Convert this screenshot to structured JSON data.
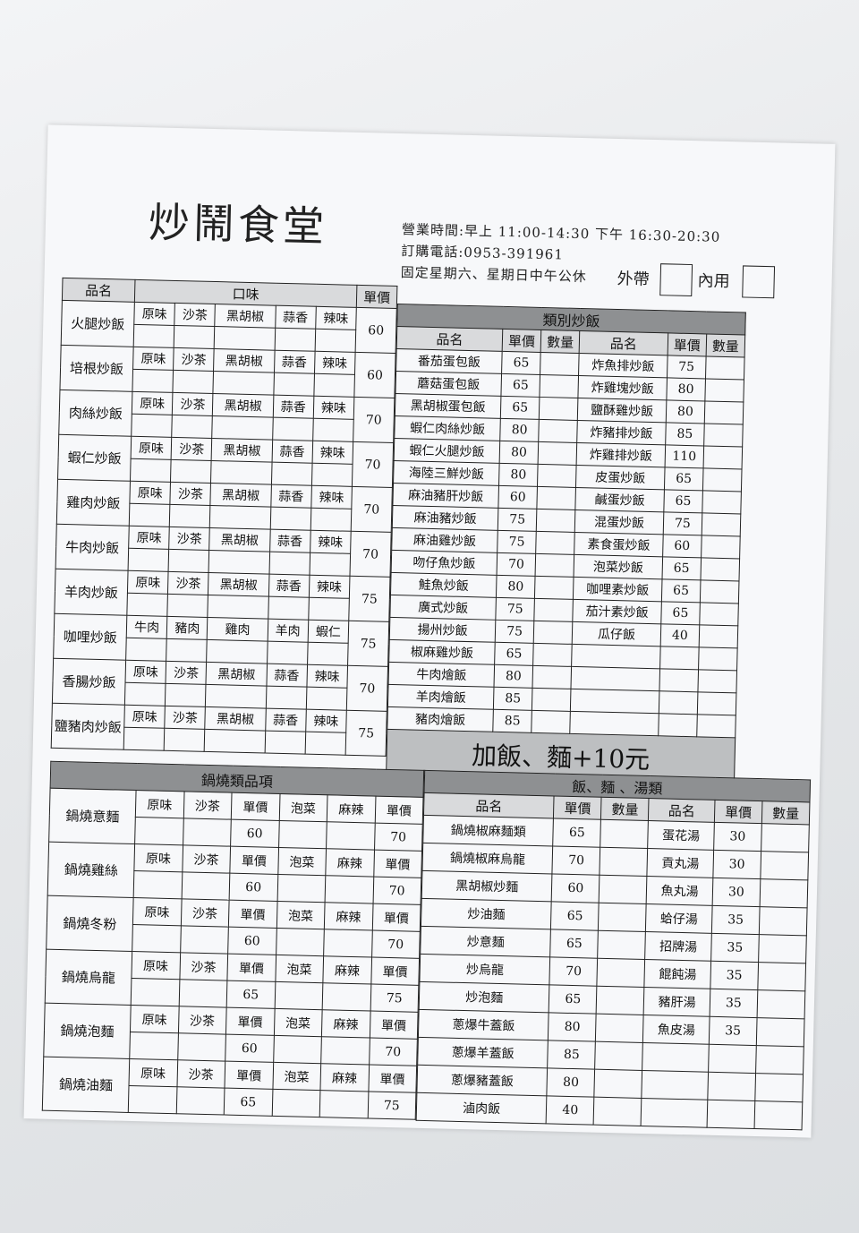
{
  "title": "炒鬧食堂",
  "info": {
    "hours": "營業時間:早上 11:00-14:30 下午 16:30-20:30",
    "phone": "訂購電話:0953-391961",
    "closed": "固定星期六、星期日中午公休",
    "takeout": "外帶",
    "dinein": "內用"
  },
  "left": {
    "col_name": "品名",
    "col_flavor": "口味",
    "col_price": "單價",
    "rows": [
      {
        "name": "火腿炒飯",
        "opts": [
          "原味",
          "沙茶",
          "黑胡椒",
          "蒜香",
          "辣味"
        ],
        "price": "60"
      },
      {
        "name": "培根炒飯",
        "opts": [
          "原味",
          "沙茶",
          "黑胡椒",
          "蒜香",
          "辣味"
        ],
        "price": "60"
      },
      {
        "name": "肉絲炒飯",
        "opts": [
          "原味",
          "沙茶",
          "黑胡椒",
          "蒜香",
          "辣味"
        ],
        "price": "70"
      },
      {
        "name": "蝦仁炒飯",
        "opts": [
          "原味",
          "沙茶",
          "黑胡椒",
          "蒜香",
          "辣味"
        ],
        "price": "70"
      },
      {
        "name": "雞肉炒飯",
        "opts": [
          "原味",
          "沙茶",
          "黑胡椒",
          "蒜香",
          "辣味"
        ],
        "price": "70"
      },
      {
        "name": "牛肉炒飯",
        "opts": [
          "原味",
          "沙茶",
          "黑胡椒",
          "蒜香",
          "辣味"
        ],
        "price": "70"
      },
      {
        "name": "羊肉炒飯",
        "opts": [
          "原味",
          "沙茶",
          "黑胡椒",
          "蒜香",
          "辣味"
        ],
        "price": "75"
      },
      {
        "name": "咖哩炒飯",
        "opts": [
          "牛肉",
          "豬肉",
          "雞肉",
          "羊肉",
          "蝦仁"
        ],
        "price": "75"
      },
      {
        "name": "香腸炒飯",
        "opts": [
          "原味",
          "沙茶",
          "黑胡椒",
          "蒜香",
          "辣味"
        ],
        "price": "70"
      },
      {
        "name": "鹽豬肉炒飯",
        "opts": [
          "原味",
          "沙茶",
          "黑胡椒",
          "蒜香",
          "辣味"
        ],
        "price": "75"
      }
    ]
  },
  "special": {
    "header": "類別炒飯",
    "col_name": "品名",
    "col_price": "單價",
    "col_qty": "數量",
    "left": [
      [
        "番茄蛋包飯",
        "65"
      ],
      [
        "蘑菇蛋包飯",
        "65"
      ],
      [
        "黑胡椒蛋包飯",
        "65"
      ],
      [
        "蝦仁肉絲炒飯",
        "80"
      ],
      [
        "蝦仁火腿炒飯",
        "80"
      ],
      [
        "海陸三鮮炒飯",
        "80"
      ],
      [
        "麻油豬肝炒飯",
        "60"
      ],
      [
        "麻油豬炒飯",
        "75"
      ],
      [
        "麻油雞炒飯",
        "75"
      ],
      [
        "吻仔魚炒飯",
        "70"
      ],
      [
        "鮭魚炒飯",
        "80"
      ],
      [
        "廣式炒飯",
        "75"
      ],
      [
        "揚州炒飯",
        "75"
      ],
      [
        "椒麻雞炒飯",
        "65"
      ],
      [
        "牛肉燴飯",
        "80"
      ],
      [
        "羊肉燴飯",
        "85"
      ],
      [
        "豬肉燴飯",
        "85"
      ]
    ],
    "right": [
      [
        "炸魚排炒飯",
        "75"
      ],
      [
        "炸雞塊炒飯",
        "80"
      ],
      [
        "鹽酥雞炒飯",
        "80"
      ],
      [
        "炸豬排炒飯",
        "85"
      ],
      [
        "炸雞排炒飯",
        "110"
      ],
      [
        "皮蛋炒飯",
        "65"
      ],
      [
        "鹹蛋炒飯",
        "65"
      ],
      [
        "混蛋炒飯",
        "75"
      ],
      [
        "素食蛋炒飯",
        "60"
      ],
      [
        "泡菜炒飯",
        "65"
      ],
      [
        "咖哩素炒飯",
        "65"
      ],
      [
        "茄汁素炒飯",
        "65"
      ],
      [
        "瓜仔飯",
        "40"
      ]
    ]
  },
  "banner": "加飯、麵+10元",
  "pot": {
    "header": "鍋燒類品項",
    "rows": [
      {
        "name": "鍋燒意麵",
        "p1": "60",
        "p2": "70"
      },
      {
        "name": "鍋燒雞絲",
        "p1": "60",
        "p2": "70"
      },
      {
        "name": "鍋燒冬粉",
        "p1": "60",
        "p2": "70"
      },
      {
        "name": "鍋燒烏龍",
        "p1": "65",
        "p2": "75"
      },
      {
        "name": "鍋燒泡麵",
        "p1": "60",
        "p2": "70"
      },
      {
        "name": "鍋燒油麵",
        "p1": "65",
        "p2": "75"
      }
    ],
    "o1": "原味",
    "o2": "沙茶",
    "pr": "單價",
    "o3": "泡菜",
    "o4": "麻辣"
  },
  "noodles": {
    "header": "飯、麵 、湯類",
    "col_name": "品名",
    "col_price": "單價",
    "col_qty": "數量",
    "left": [
      [
        "鍋燒椒麻麵類",
        "65"
      ],
      [
        "鍋燒椒麻烏龍",
        "70"
      ],
      [
        "黑胡椒炒麵",
        "60"
      ],
      [
        "炒油麵",
        "65"
      ],
      [
        "炒意麵",
        "65"
      ],
      [
        "炒烏龍",
        "70"
      ],
      [
        "炒泡麵",
        "65"
      ],
      [
        "蔥爆牛蓋飯",
        "80"
      ],
      [
        "蔥爆羊蓋飯",
        "85"
      ],
      [
        "蔥爆豬蓋飯",
        "80"
      ],
      [
        "滷肉飯",
        "40"
      ]
    ],
    "right": [
      [
        "蛋花湯",
        "30"
      ],
      [
        "貢丸湯",
        "30"
      ],
      [
        "魚丸湯",
        "30"
      ],
      [
        "蛤仔湯",
        "35"
      ],
      [
        "招牌湯",
        "35"
      ],
      [
        "餛飩湯",
        "35"
      ],
      [
        "豬肝湯",
        "35"
      ],
      [
        "魚皮湯",
        "35"
      ]
    ]
  }
}
